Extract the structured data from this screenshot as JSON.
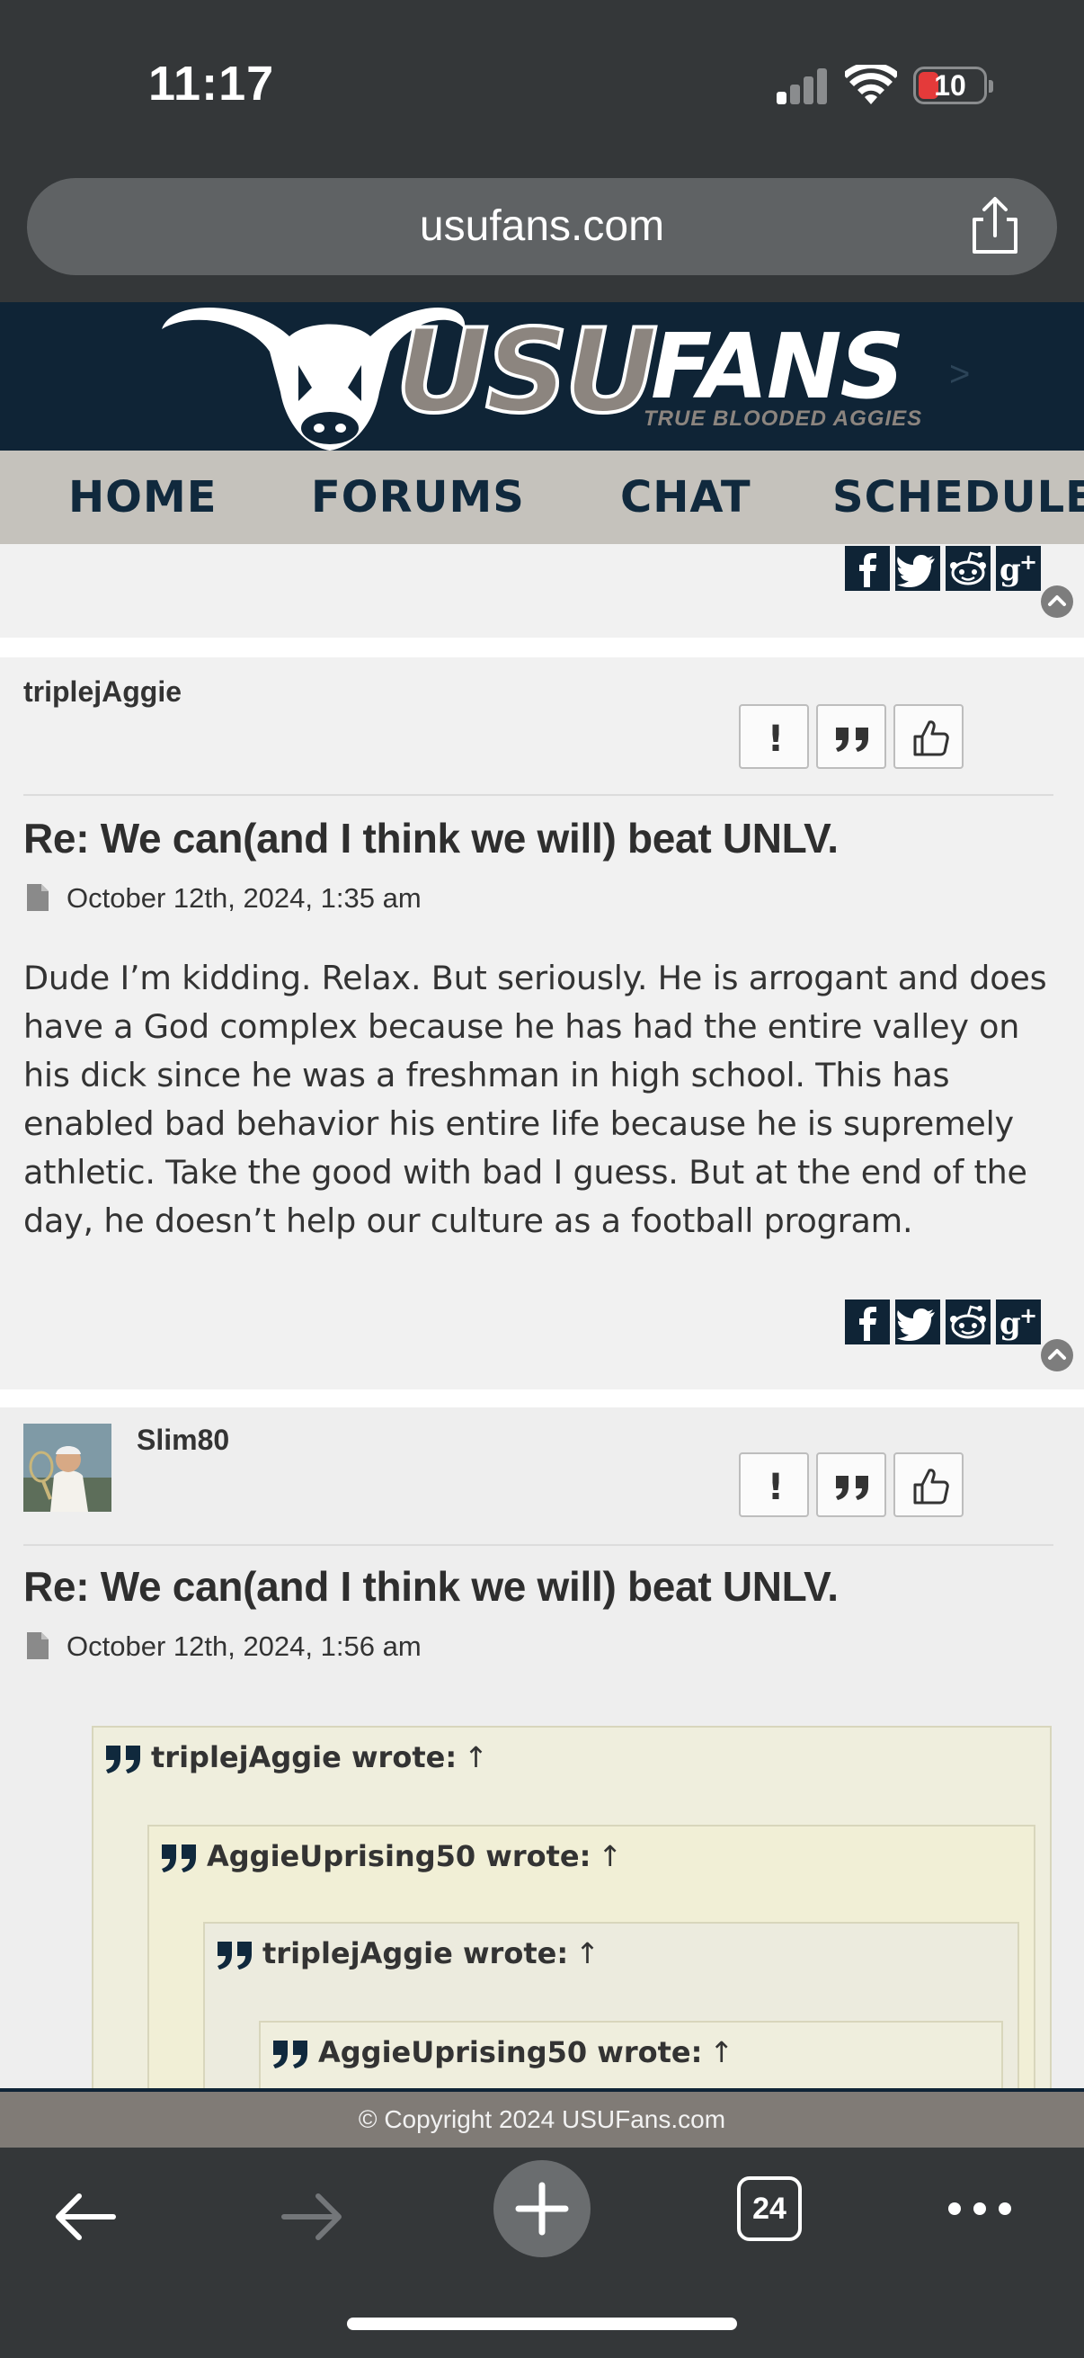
{
  "status_bar": {
    "time": "11:17",
    "battery": "10"
  },
  "browser": {
    "url": "usufans.com",
    "open_tabs": "24"
  },
  "site": {
    "logo_usu": "USU",
    "logo_fans": "FANS",
    "logo_tagline": "TRUE BLOODED AGGIES",
    "logo_arrow": ">"
  },
  "nav": {
    "home": "HOME",
    "forums": "FORUMS",
    "chat": "CHAT",
    "schedule": "SCHEDULE"
  },
  "posts": [
    {
      "author": "triplejAggie",
      "title": "Re: We can(and I think we will) beat UNLV.",
      "date": "October 12th, 2024, 1:35 am",
      "body": "Dude I’m kidding. Relax. But seriously. He is arrogant and does have a God complex because he has had the entire valley on his dick since he was a freshman in high school. This has enabled bad behavior his entire life because he is supremely athletic. Take the good with bad I guess. But at the end of the day, he doesn’t help our culture as a football program."
    },
    {
      "author": "Slim80",
      "title": "Re: We can(and I think we will) beat UNLV.",
      "date": "October 12th, 2024, 1:56 am",
      "quotes": [
        {
          "header": "triplejAggie wrote:",
          "arrow": "↑"
        },
        {
          "header": "AggieUprising50 wrote:",
          "arrow": "↑"
        },
        {
          "header": "triplejAggie wrote:",
          "arrow": "↑"
        },
        {
          "header": "AggieUprising50 wrote:",
          "arrow": "↑"
        }
      ]
    }
  ],
  "action_buttons": {
    "report": "!"
  },
  "footer": {
    "copyright": "© Copyright 2024 USUFans.com"
  },
  "colors": {
    "navy": "#0f2436",
    "nav_bg": "#c5c2bc",
    "footer_bg": "#807b76",
    "quote_bg": "#efeedd"
  }
}
